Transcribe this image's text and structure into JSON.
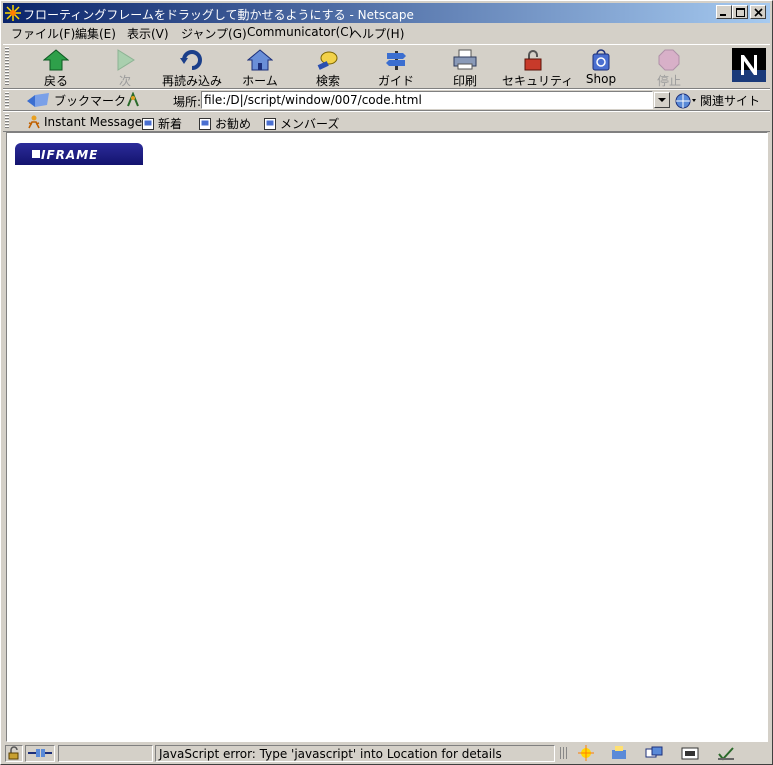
{
  "window": {
    "title": "フローティングフレームをドラッグして動かせるようにする - Netscape"
  },
  "menu": [
    "ファイル(F)",
    "編集(E)",
    "表示(V)",
    "ジャンプ(G)",
    "Communicator(C)",
    "ヘルプ(H)"
  ],
  "nav_toolbar": {
    "back": "戻る",
    "forward": "次",
    "reload": "再読み込み",
    "home": "ホーム",
    "search": "検索",
    "guide": "ガイド",
    "print": "印刷",
    "security": "セキュリティ",
    "shop": "Shop",
    "stop": "停止"
  },
  "location_bar": {
    "bookmarks_label": "ブックマーク",
    "location_label": "場所:",
    "url": "file:/D|/script/window/007/code.html",
    "related_label": "関連サイト"
  },
  "personal_toolbar": {
    "instant_message": "Instant Message",
    "new": "新着",
    "recommend": "お勧め",
    "members": "メンバーズ"
  },
  "content": {
    "tab_label": "IFRAME"
  },
  "status_bar": {
    "message": "JavaScript error: Type 'javascript' into Location for details"
  }
}
